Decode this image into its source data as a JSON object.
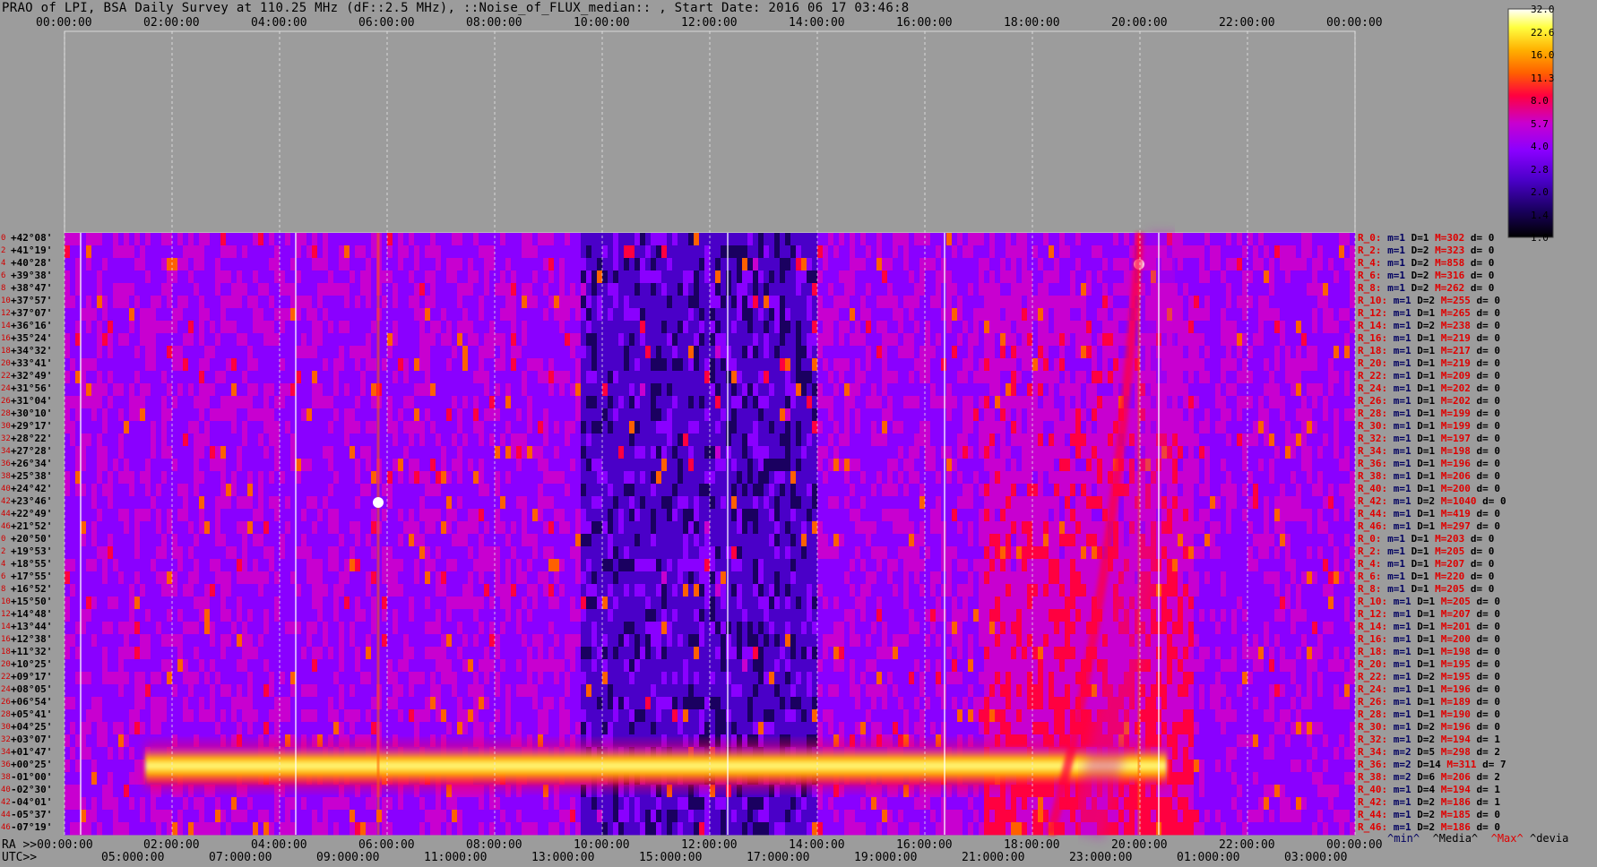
{
  "title": "PRAO of LPI, BSA Daily Survey at 110.25 MHz (dF::2.5 MHz), ::Noise_of_FLUX_median:: , Start Date: 2016 06 17 03:46:8",
  "top_axis_ticks": [
    "00:00:00",
    "02:00:00",
    "04:00:00",
    "06:00:00",
    "08:00:00",
    "10:00:00",
    "12:00:00",
    "14:00:00",
    "16:00:00",
    "18:00:00",
    "20:00:00",
    "22:00:00",
    "00:00:00"
  ],
  "ra_axis": {
    "prefix": "RA >>00:00:00",
    "ticks": [
      "02:00:00",
      "04:00:00",
      "06:00:00",
      "08:00:00",
      "10:00:00",
      "12:00:00",
      "14:00:00",
      "16:00:00",
      "18:00:00",
      "20:00:00",
      "22:00:00",
      "00:00:00"
    ]
  },
  "utc_axis": {
    "prefix": "UTC>>",
    "ticks": [
      "05:0",
      "00:00",
      "07:0",
      "00:00",
      "09:0",
      "00:00",
      "11:0",
      "00:00",
      "13:0",
      "00:00",
      "15:0",
      "00:00",
      "17:0",
      "00:00",
      "19:0",
      "00:00",
      "21:0",
      "00:00",
      "23:0",
      "00:00",
      "01:0",
      "00:00",
      "03:0",
      "00:00"
    ]
  },
  "declinations": [
    "+42°08'",
    "+41°19'",
    "+40°28'",
    "+39°38'",
    "+38°47'",
    "+37°57'",
    "+37°07'",
    "+36°16'",
    "+35°24'",
    "+34°32'",
    "+33°41'",
    "+32°49'",
    "+31°56'",
    "+31°04'",
    "+30°10'",
    "+29°17'",
    "+28°22'",
    "+27°28'",
    "+26°34'",
    "+25°38'",
    "+24°42'",
    "+23°46'",
    "+22°49'",
    "+21°52'",
    "+20°50'",
    "+19°53'",
    "+18°55'",
    "+17°55'",
    "+16°52'",
    "+15°50'",
    "+14°48'",
    "+13°44'",
    "+12°38'",
    "+11°32'",
    "+10°25'",
    "+09°17'",
    "+08°05'",
    "+06°54'",
    "+05°41'",
    "+04°25'",
    "+03°07'",
    "+01°47'",
    "+00°25'",
    "-01°00'",
    "-02°30'",
    "-04°01'",
    "-05°37'",
    "-07°19'"
  ],
  "row_numbers": [
    "0",
    "2",
    "4",
    "6",
    "8",
    "10",
    "12",
    "14",
    "16",
    "18",
    "20",
    "22",
    "24",
    "26",
    "28",
    "30",
    "32",
    "34",
    "36",
    "38",
    "40",
    "42",
    "44",
    "46",
    "0",
    "2",
    "4",
    "6",
    "8",
    "10",
    "12",
    "14",
    "16",
    "18",
    "20",
    "22",
    "24",
    "26",
    "28",
    "30",
    "32",
    "34",
    "36",
    "38",
    "40",
    "42",
    "44",
    "46"
  ],
  "row_stats": [
    {
      "r": "R_0:",
      "m": "m=1",
      "d": "D=1",
      "M": "M=302",
      "dv": "d= 0"
    },
    {
      "r": "R_2:",
      "m": "m=1",
      "d": "D=2",
      "M": "M=323",
      "dv": "d= 0"
    },
    {
      "r": "R_4:",
      "m": "m=1",
      "d": "D=2",
      "M": "M=858",
      "dv": "d= 0"
    },
    {
      "r": "R_6:",
      "m": "m=1",
      "d": "D=2",
      "M": "M=316",
      "dv": "d= 0"
    },
    {
      "r": "R_8:",
      "m": "m=1",
      "d": "D=2",
      "M": "M=262",
      "dv": "d= 0"
    },
    {
      "r": "R_10:",
      "m": "m=1",
      "d": "D=2",
      "M": "M=255",
      "dv": "d= 0"
    },
    {
      "r": "R_12:",
      "m": "m=1",
      "d": "D=1",
      "M": "M=265",
      "dv": "d= 0"
    },
    {
      "r": "R_14:",
      "m": "m=1",
      "d": "D=2",
      "M": "M=238",
      "dv": "d= 0"
    },
    {
      "r": "R_16:",
      "m": "m=1",
      "d": "D=1",
      "M": "M=219",
      "dv": "d= 0"
    },
    {
      "r": "R_18:",
      "m": "m=1",
      "d": "D=1",
      "M": "M=217",
      "dv": "d= 0"
    },
    {
      "r": "R_20:",
      "m": "m=1",
      "d": "D=1",
      "M": "M=219",
      "dv": "d= 0"
    },
    {
      "r": "R_22:",
      "m": "m=1",
      "d": "D=1",
      "M": "M=209",
      "dv": "d= 0"
    },
    {
      "r": "R_24:",
      "m": "m=1",
      "d": "D=1",
      "M": "M=202",
      "dv": "d= 0"
    },
    {
      "r": "R_26:",
      "m": "m=1",
      "d": "D=1",
      "M": "M=202",
      "dv": "d= 0"
    },
    {
      "r": "R_28:",
      "m": "m=1",
      "d": "D=1",
      "M": "M=199",
      "dv": "d= 0"
    },
    {
      "r": "R_30:",
      "m": "m=1",
      "d": "D=1",
      "M": "M=199",
      "dv": "d= 0"
    },
    {
      "r": "R_32:",
      "m": "m=1",
      "d": "D=1",
      "M": "M=197",
      "dv": "d= 0"
    },
    {
      "r": "R_34:",
      "m": "m=1",
      "d": "D=1",
      "M": "M=198",
      "dv": "d= 0"
    },
    {
      "r": "R_36:",
      "m": "m=1",
      "d": "D=1",
      "M": "M=196",
      "dv": "d= 0"
    },
    {
      "r": "R_38:",
      "m": "m=1",
      "d": "D=1",
      "M": "M=206",
      "dv": "d= 0"
    },
    {
      "r": "R_40:",
      "m": "m=1",
      "d": "D=1",
      "M": "M=200",
      "dv": "d= 0"
    },
    {
      "r": "R_42:",
      "m": "m=1",
      "d": "D=2",
      "M": "M=1040",
      "dv": "d= 0"
    },
    {
      "r": "R_44:",
      "m": "m=1",
      "d": "D=1",
      "M": "M=419",
      "dv": "d= 0"
    },
    {
      "r": "R_46:",
      "m": "m=1",
      "d": "D=1",
      "M": "M=297",
      "dv": "d= 0"
    },
    {
      "r": "R_0:",
      "m": "m=1",
      "d": "D=1",
      "M": "M=203",
      "dv": "d= 0"
    },
    {
      "r": "R_2:",
      "m": "m=1",
      "d": "D=1",
      "M": "M=205",
      "dv": "d= 0"
    },
    {
      "r": "R_4:",
      "m": "m=1",
      "d": "D=1",
      "M": "M=207",
      "dv": "d= 0"
    },
    {
      "r": "R_6:",
      "m": "m=1",
      "d": "D=1",
      "M": "M=220",
      "dv": "d= 0"
    },
    {
      "r": "R_8:",
      "m": "m=1",
      "d": "D=1",
      "M": "M=205",
      "dv": "d= 0"
    },
    {
      "r": "R_10:",
      "m": "m=1",
      "d": "D=1",
      "M": "M=205",
      "dv": "d= 0"
    },
    {
      "r": "R_12:",
      "m": "m=1",
      "d": "D=1",
      "M": "M=207",
      "dv": "d= 0"
    },
    {
      "r": "R_14:",
      "m": "m=1",
      "d": "D=1",
      "M": "M=201",
      "dv": "d= 0"
    },
    {
      "r": "R_16:",
      "m": "m=1",
      "d": "D=1",
      "M": "M=200",
      "dv": "d= 0"
    },
    {
      "r": "R_18:",
      "m": "m=1",
      "d": "D=1",
      "M": "M=198",
      "dv": "d= 0"
    },
    {
      "r": "R_20:",
      "m": "m=1",
      "d": "D=1",
      "M": "M=195",
      "dv": "d= 0"
    },
    {
      "r": "R_22:",
      "m": "m=1",
      "d": "D=2",
      "M": "M=195",
      "dv": "d= 0"
    },
    {
      "r": "R_24:",
      "m": "m=1",
      "d": "D=1",
      "M": "M=196",
      "dv": "d= 0"
    },
    {
      "r": "R_26:",
      "m": "m=1",
      "d": "D=1",
      "M": "M=189",
      "dv": "d= 0"
    },
    {
      "r": "R_28:",
      "m": "m=1",
      "d": "D=1",
      "M": "M=190",
      "dv": "d= 0"
    },
    {
      "r": "R_30:",
      "m": "m=1",
      "d": "D=2",
      "M": "M=196",
      "dv": "d= 0"
    },
    {
      "r": "R_32:",
      "m": "m=1",
      "d": "D=2",
      "M": "M=194",
      "dv": "d= 1"
    },
    {
      "r": "R_34:",
      "m": "m=2",
      "d": "D=5",
      "M": "M=298",
      "dv": "d= 2"
    },
    {
      "r": "R_36:",
      "m": "m=2",
      "d": "D=14",
      "M": "M=311",
      "dv": "d= 7"
    },
    {
      "r": "R_38:",
      "m": "m=2",
      "d": "D=6",
      "M": "M=206",
      "dv": "d= 2"
    },
    {
      "r": "R_40:",
      "m": "m=1",
      "d": "D=4",
      "M": "M=194",
      "dv": "d= 1"
    },
    {
      "r": "R_42:",
      "m": "m=1",
      "d": "D=2",
      "M": "M=186",
      "dv": "d= 1"
    },
    {
      "r": "R_44:",
      "m": "m=1",
      "d": "D=2",
      "M": "M=185",
      "dv": "d= 0"
    },
    {
      "r": "R_46:",
      "m": "m=1",
      "d": "D=2",
      "M": "M=186",
      "dv": "d= 0"
    }
  ],
  "stats_legend": {
    "min": "^min^",
    "media": "^Media^",
    "max": "^Max^",
    "devia": "^devia"
  },
  "colorbar": {
    "ticks": [
      "32.0",
      "22.6",
      "16.0",
      "11.3",
      "8.0",
      "5.7",
      "4.0",
      "2.8",
      "2.0",
      "1.4",
      "1.0"
    ],
    "colors": [
      "#000000",
      "#1a0060",
      "#4a00c8",
      "#8a00ff",
      "#c800d0",
      "#ff0040",
      "#ff6000",
      "#ffb000",
      "#ffff40",
      "#ffffff"
    ]
  },
  "chart_data": {
    "type": "heatmap",
    "title": "PRAO of LPI, BSA Daily Survey at 110.25 MHz (dF::2.5 MHz), ::Noise_of_FLUX_median:: , Start Date: 2016 06 17 03:46:8",
    "x_axis": "RA 00:00:00 – 00:00:00 (24 h)",
    "y_axis": "Declination +42°08' to -07°19' (48 beams)",
    "value_scale": "log, 1.0 – 32.0",
    "features": [
      {
        "kind": "horizontal_band",
        "dec": "+00°25'",
        "ra_start": "01:30:00",
        "ra_end": "20:30:00",
        "level": "high"
      },
      {
        "kind": "point_source",
        "ra": "05:50:00",
        "dec": "+23°46'",
        "level": "32.0"
      },
      {
        "kind": "point_source",
        "ra": "19:59:00",
        "dec": "+40°28'",
        "level": "32.0"
      },
      {
        "kind": "diagonal_track",
        "ra_start": "18:20:00",
        "ra_end": "20:00:00",
        "level": "8.0"
      }
    ]
  }
}
